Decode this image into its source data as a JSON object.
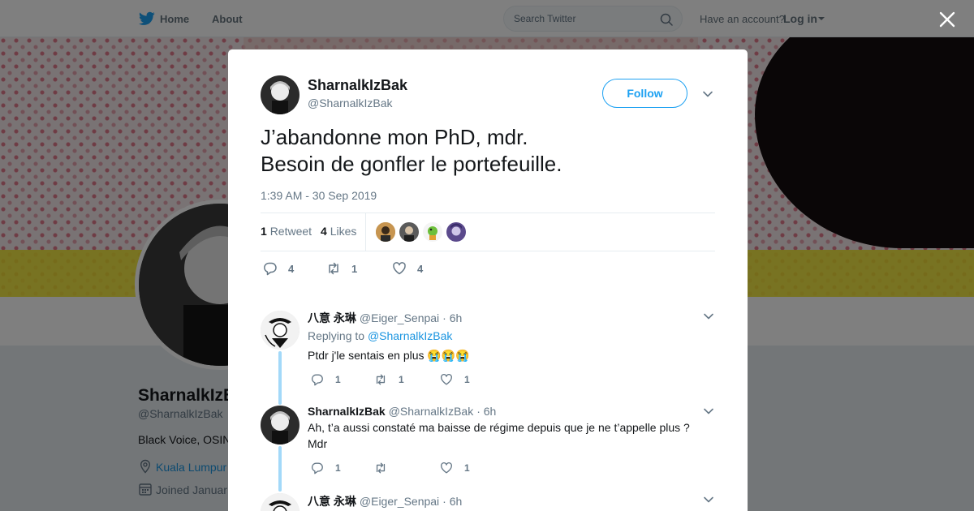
{
  "topbar": {
    "home_label": "Home",
    "about_label": "About",
    "search_placeholder": "Search Twitter",
    "account_question": "Have an account?",
    "login_label": "Log in"
  },
  "profile": {
    "name": "SharnalkIzBak",
    "handle": "@SharnalkIzBak",
    "bio": "Black Voice, OSIN",
    "location": "Kuala Lumpur",
    "joined": "Joined Januar"
  },
  "tweet": {
    "author_name": "SharnalkIzBak",
    "author_handle": "@SharnalkIzBak",
    "follow_label": "Follow",
    "text_line1": "J’abandonne mon PhD, mdr.",
    "text_line2": "Besoin de gonfler le portefeuille.",
    "timestamp": "1:39 AM - 30 Sep 2019",
    "retweet_count": "1",
    "retweet_label": "Retweet",
    "like_count": "4",
    "like_label": "Likes",
    "actions": {
      "reply_count": "4",
      "retweet_count": "1",
      "like_count": "4"
    }
  },
  "replies": [
    {
      "name": "八意 永琳",
      "handle": "@Eiger_Senpai",
      "time": "· 6h",
      "replying_prefix": "Replying to",
      "replying_to": "@SharnalkIzBak",
      "text": "Ptdr j'le sentais en plus 😭😭😭",
      "reply_count": "1",
      "retweet_count": "1",
      "like_count": "1"
    },
    {
      "name": "SharnalkIzBak",
      "handle": "@SharnalkIzBak",
      "time": "· 6h",
      "text_line1": "Ah, t’a aussi constaté ma baisse de régime depuis que je ne t’appelle plus ?",
      "text_line2": "Mdr",
      "reply_count": "1",
      "retweet_count": "",
      "like_count": "1"
    },
    {
      "name": "八意 永琳",
      "handle": "@Eiger_Senpai",
      "time": "· 6h"
    }
  ],
  "colors": {
    "twitter_blue": "#1da1f2",
    "link_blue": "#1b95e0",
    "thread_line": "#a3d9f9",
    "muted_text": "#657786"
  },
  "icons": [
    "twitter-bird-icon",
    "search-icon",
    "close-icon",
    "chevron-down-icon",
    "reply-icon",
    "retweet-icon",
    "heart-icon",
    "location-icon",
    "calendar-icon"
  ]
}
